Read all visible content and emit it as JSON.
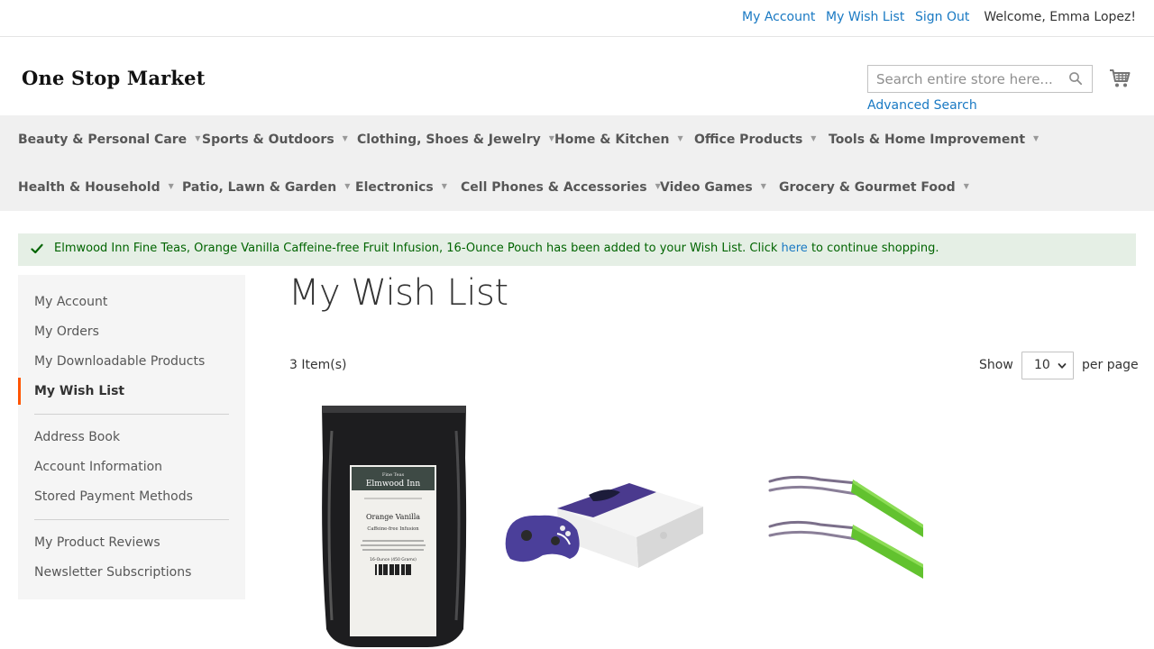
{
  "header": {
    "links": [
      "My Account",
      "My Wish List",
      "Sign Out"
    ],
    "welcome": "Welcome, Emma Lopez!"
  },
  "logo": {
    "text": "One Stop Market"
  },
  "search": {
    "placeholder": "Search entire store here...",
    "advanced_label": "Advanced Search",
    "icon": "search-icon"
  },
  "cart": {
    "icon": "shopping-cart-icon"
  },
  "nav": {
    "row1": [
      "Beauty & Personal Care",
      "Sports & Outdoors",
      "Clothing, Shoes & Jewelry",
      "Home & Kitchen",
      "Office Products",
      "Tools & Home Improvement"
    ],
    "row2": [
      "Health & Household",
      "Patio, Lawn & Garden",
      "Electronics",
      "Cell Phones & Accessories",
      "Video Games",
      "Grocery & Gourmet Food"
    ]
  },
  "message": {
    "text_before": "Elmwood Inn Fine Teas, Orange Vanilla Caffeine-free Fruit Infusion, 16-Ounce Pouch has been added to your Wish List. Click ",
    "link": "here",
    "text_after": " to continue shopping.",
    "color": "#006400",
    "background": "#e5efe5"
  },
  "sidebar": {
    "group1": [
      "My Account",
      "My Orders",
      "My Downloadable Products",
      "My Wish List"
    ],
    "group2": [
      "Address Book",
      "Account Information",
      "Stored Payment Methods"
    ],
    "group3": [
      "My Product Reviews",
      "Newsletter Subscriptions"
    ],
    "current": "My Wish List",
    "accent_color": "#ff5501"
  },
  "main": {
    "title": "My Wish List",
    "count": "3 Item(s)",
    "limiter": {
      "show": "Show",
      "value": "10",
      "per_page": "per page"
    }
  },
  "products": [
    {
      "image": "tea-pouch-image",
      "brand": "Elmwood Inn",
      "brand_top": "Fine Teas",
      "flavor": "Orange Vanilla",
      "sub": "Caffeine-free Infusion",
      "size": "16-Ounce (450 Grams)"
    },
    {
      "image": "console-skin-image"
    },
    {
      "image": "tweezers-image"
    }
  ],
  "colors": {
    "link": "#1979c3",
    "nav_bg": "#f0f0f0",
    "sidebar_bg": "#f5f5f5"
  }
}
